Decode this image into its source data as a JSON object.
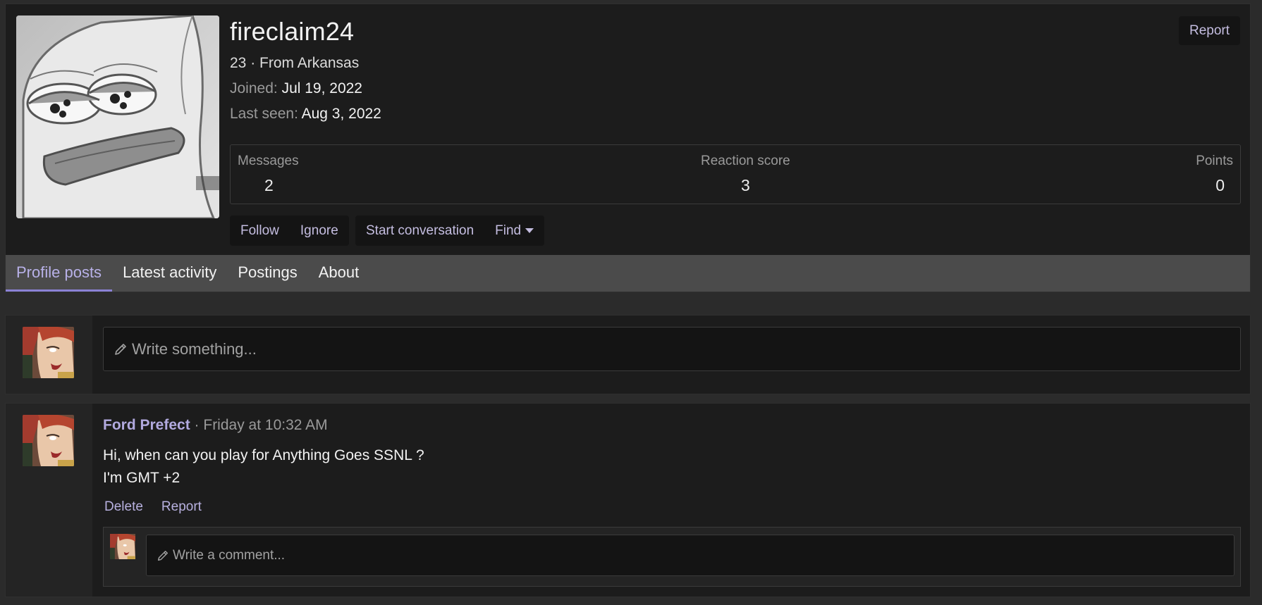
{
  "profile": {
    "username": "fireclaim24",
    "age_location": "23 · From Arkansas",
    "joined_label": "Joined:",
    "joined_value": "Jul 19, 2022",
    "last_seen_label": "Last seen:",
    "last_seen_value": "Aug 3, 2022",
    "report_label": "Report"
  },
  "stats": {
    "messages_label": "Messages",
    "messages_value": "2",
    "reaction_label": "Reaction score",
    "reaction_value": "3",
    "points_label": "Points",
    "points_value": "0"
  },
  "actions": {
    "follow": "Follow",
    "ignore": "Ignore",
    "start_conversation": "Start conversation",
    "find": "Find"
  },
  "tabs": [
    {
      "label": "Profile posts",
      "active": true
    },
    {
      "label": "Latest activity",
      "active": false
    },
    {
      "label": "Postings",
      "active": false
    },
    {
      "label": "About",
      "active": false
    }
  ],
  "new_post": {
    "placeholder": "Write something..."
  },
  "post": {
    "author": "Ford Prefect",
    "time": " · Friday at 10:32 AM",
    "line1": "Hi, when can you play for Anything Goes SSNL ?",
    "line2": "I'm GMT +2",
    "delete_label": "Delete",
    "report_label": "Report",
    "comment_placeholder": "Write a comment..."
  },
  "colors": {
    "accent": "#8b82d6",
    "link": "#c4bde0",
    "panel": "#1c1c1c",
    "tabbar": "#4b4b4b"
  }
}
